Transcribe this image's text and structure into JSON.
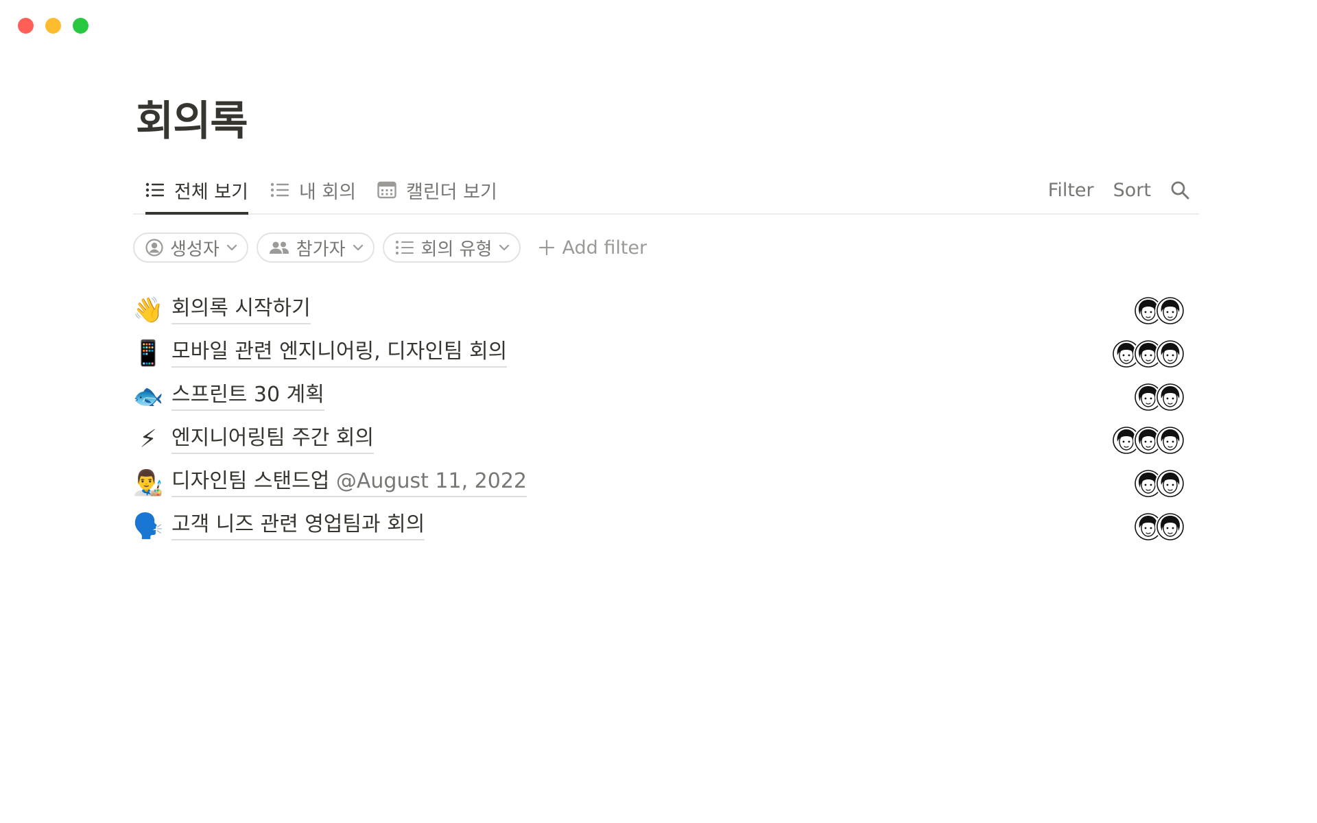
{
  "window": {
    "controls": [
      "close",
      "minimize",
      "maximize"
    ]
  },
  "page": {
    "title": "회의록"
  },
  "tabs": [
    {
      "label": "전체 보기",
      "icon": "list-icon",
      "active": true
    },
    {
      "label": "내 회의",
      "icon": "list-icon",
      "active": false
    },
    {
      "label": "캘린더 보기",
      "icon": "calendar-icon",
      "active": false
    }
  ],
  "actions": {
    "filter": "Filter",
    "sort": "Sort",
    "search_icon": "search-icon"
  },
  "filters": [
    {
      "label": "생성자",
      "icon": "person-circle-icon"
    },
    {
      "label": "참가자",
      "icon": "people-icon"
    },
    {
      "label": "회의 유형",
      "icon": "list-icon"
    }
  ],
  "add_filter": "Add filter",
  "meetings": [
    {
      "emoji": "👋",
      "title": "회의록 시작하기",
      "mention": "",
      "participants": 2
    },
    {
      "emoji": "📱",
      "title": "모바일 관련 엔지니어링, 디자인팀 회의",
      "mention": "",
      "participants": 3
    },
    {
      "emoji": "🐟",
      "title": "스프린트 30 계획",
      "mention": "",
      "participants": 2
    },
    {
      "emoji": "⚡",
      "title": "엔지니어링팀 주간 회의",
      "mention": "",
      "participants": 3
    },
    {
      "emoji": "👨‍🎨",
      "title": "디자인팀 스탠드업 ",
      "mention": "@August 11, 2022",
      "participants": 2
    },
    {
      "emoji": "🗣️",
      "title": "고객 니즈 관련 영업팀과 회의",
      "mention": "",
      "participants": 2
    }
  ]
}
